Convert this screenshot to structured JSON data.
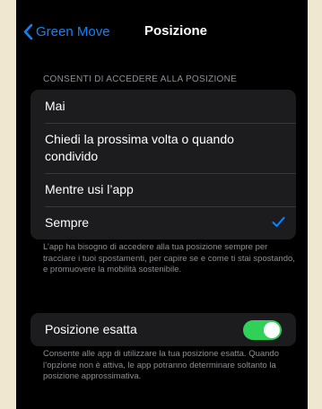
{
  "navbar": {
    "back_label": "Green Move",
    "title": "Posizione"
  },
  "location_access": {
    "header": "CONSENTI DI ACCEDERE ALLA POSIZIONE",
    "options": [
      {
        "label": "Mai",
        "selected": false
      },
      {
        "label": "Chiedi la prossima volta o quando condivido",
        "selected": false
      },
      {
        "label": "Mentre usi l’app",
        "selected": false
      },
      {
        "label": "Sempre",
        "selected": true
      }
    ],
    "footer": "L’app ha bisogno di accedere alla tua posizione sempre per tracciare i tuoi spostamenti, per capire se e come ti stai spostando, e promuovere la mobilità sostenibile."
  },
  "precise_location": {
    "label": "Posizione esatta",
    "enabled": true,
    "footer": "Consente alle app di utilizzare la tua posizione esatta. Quando l’opzione non è attiva, le app potranno determinare soltanto la posizione approssimativa."
  },
  "icons": {
    "back": "chevron-left-icon",
    "selected": "checkmark-icon"
  },
  "colors": {
    "background": "#000000",
    "cell": "#1c1c1e",
    "accent": "#0a84ff",
    "toggle_on": "#30d158",
    "secondary_text": "#8e8e93",
    "page_backdrop": "#efe7cf"
  }
}
